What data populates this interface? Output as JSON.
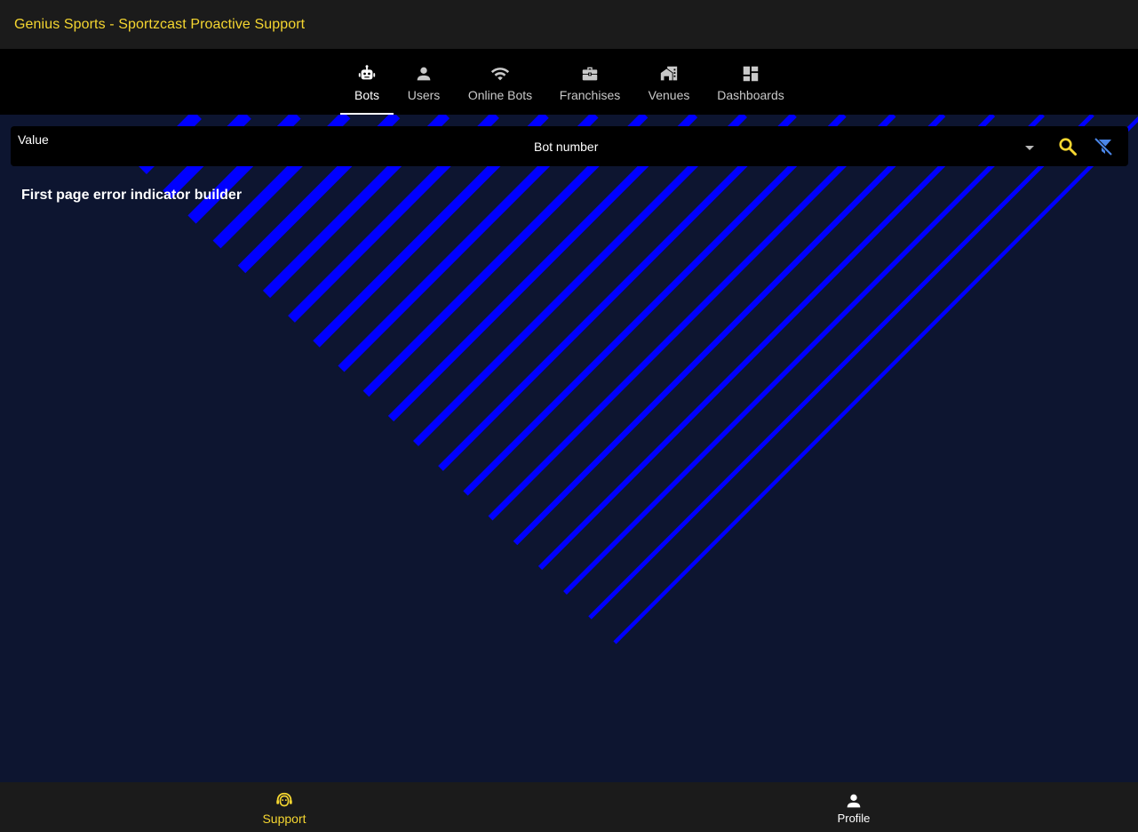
{
  "app_bar": {
    "title": "Genius Sports - Sportzcast Proactive Support"
  },
  "tabs": [
    {
      "id": "bots",
      "label": "Bots",
      "icon": "robot-icon",
      "active": true
    },
    {
      "id": "users",
      "label": "Users",
      "icon": "person-icon",
      "active": false
    },
    {
      "id": "online-bots",
      "label": "Online Bots",
      "icon": "wifi-icon",
      "active": false
    },
    {
      "id": "franchises",
      "label": "Franchises",
      "icon": "briefcase-icon",
      "active": false
    },
    {
      "id": "venues",
      "label": "Venues",
      "icon": "building-icon",
      "active": false
    },
    {
      "id": "dashboards",
      "label": "Dashboards",
      "icon": "dashboard-icon",
      "active": false
    }
  ],
  "search": {
    "value_label": "Value",
    "selected_field": "Bot number"
  },
  "main": {
    "heading": "First page error indicator builder"
  },
  "bottom_nav": {
    "support_label": "Support",
    "profile_label": "Profile"
  },
  "colors": {
    "accent_yellow": "#f5d630",
    "stripe_blue": "#0000ff",
    "background": "#0d1530",
    "bar_dark": "#1b1b1b",
    "filter_blue": "#4a86e8"
  }
}
